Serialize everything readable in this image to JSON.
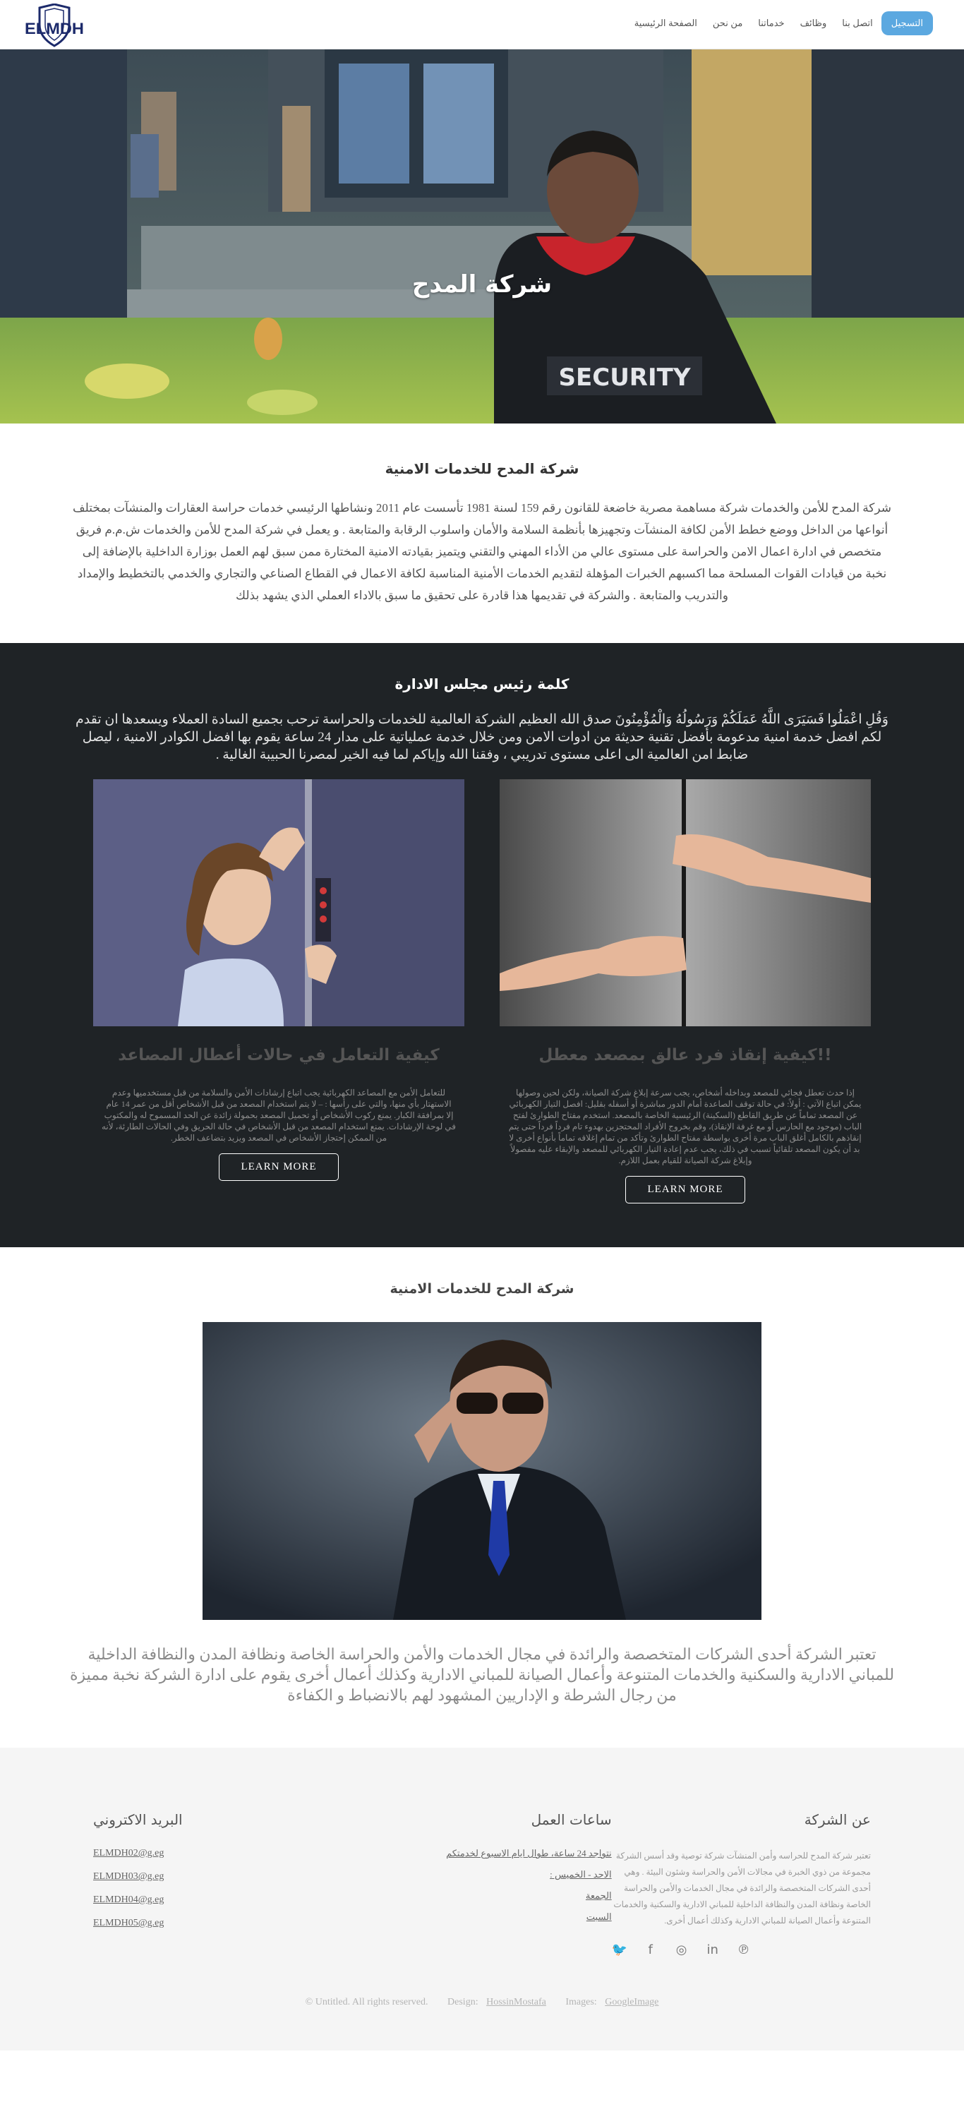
{
  "header": {
    "logo_text": "ELMDH",
    "nav": {
      "signup": "التسجيل",
      "contact": "اتصل بنا",
      "jobs": "وظائف",
      "services": "خدماتنا",
      "about": "من نحن",
      "home": "الصفحة الرئيسية"
    }
  },
  "hero": {
    "title": "شركة المدح",
    "vest_text": "SECURITY"
  },
  "intro": {
    "title": "شركة المدح للخدمات الامنية",
    "body": "شركة المدح للأمن والخدمات شركة مساهمة مصرية خاضعة للقانون رقم 159 لسنة 1981 تأسست عام 2011 ونشاطها الرئيسي خدمات حراسة العقارات والمنشآت بمختلف أنواعها من الداخل ووضع خطط الأمن لكافة المنشآت وتجهيزها بأنظمة السلامة والأمان واسلوب الرقابة والمتابعة . و يعمل في شركة المدح للأمن والخدمات ش.م.م فريق متخصص في ادارة اعمال الامن والحراسة على مستوى عالي من الأداء المهني والتقني ويتميز بقيادته الامنية المختارة ممن سبق لهم العمل بوزارة الداخلية بالإضافة إلى نخبة من قيادات القوات المسلحة مما اكسبهم الخبرات المؤهلة لتقديم الخدمات الأمنية المناسبة لكافة الاعمال في القطاع الصناعي والتجاري والخدمي بالتخطيط والإمداد والتدريب والمتابعة . والشركة في تقديمها هذا قادرة على تحقيق ما سبق بالاداء العملي الذي يشهد بذلك"
  },
  "chairman": {
    "title": "كلمة رئيس مجلس الادارة",
    "body": "وَقُلِ اعْمَلُوا فَسَيَرَى اللَّهُ عَمَلَكُمْ وَرَسُولُهُ وَالْمُؤْمِنُونَ صدق الله العظيم الشركة العالمية للخدمات والحراسة ترحب بجميع السادة العملاء ويسعدها ان تقدم لكم افضل خدمة امنية مدعومة بأفضل تقنية حديثة من ادوات الامن ومن خلال خدمة عملياتية على مدار 24 ساعة يقوم بها افضل الكوادر الامنية ، ليصل ضابط امن العالمية الى اعلى مستوى تدريبي ، وفقنا الله وإياكم لما فيه الخير لمصرنا الحبيبة الغالية .",
    "cards": [
      {
        "title": "كيفية إنقاذ فرد عالق بمصعد معطل!!",
        "body": "إذا حدث تعطل فجائي للمصعد وبداخله أشخاص، يجب سرعة إبلاغ شركة الصيانة، ولكن لحين وصولها يمكن اتباع الآتي : أولاً: في حالة توقف الصاعدة أمام الدور مباشرة أو أسفله بقليل: افصل التيار الكهربائي عن المصعد تماماً عن طريق القاطع (السكينة) الرئيسية الخاصة بالمصعد. استخدم مفتاح الطوارئ لفتح الباب (موجود مع الحارس أو مع غرفة الإنقاذ)، وقم بخروج الأفراد المحتجزين بهدوء تام فرداً فرداً حتى يتم إنقاذهم بالكامل أغلق الباب مرة أخرى بواسطة مفتاح الطوارئ وتأكد من تمام إغلاقه تماماً بأنواع أخرى لا بد أن يكون المصعد تلقائياً تسبب في ذلك، يجب عدم إعادة التيار الكهربائي للمصعد والإبقاء عليه مفصولاً وإبلاغ شركة الصيانة للقيام بعمل اللازم.",
        "button": "LEARN MORE"
      },
      {
        "title": "كيفية التعامل في حالات أعطال المصاعد",
        "body": "للتعامل الأمن مع المصاعد الكهربائية يجب اتباع إرشادات الأمن والسلامة من قبل مستخدميها وعدم الاستهتار بأي منها، والتي على رأسها : – لا يتم استخدام المصعد من قبل الأشخاص أقل من عمر 14 عام إلا بمرافقة الكبار. يمنع ركوب الأشخاص أو تحميل المصعد بحمولة زائدة عن الحد المسموح له والمكتوب في لوحة الإرشادات. يمنع استخدام المصعد من قبل الأشخاص في حالة الحريق وفي الحالات الطارئة، لأنه من الممكن إحتجاز الأشخاص في المصعد ويزيد بتضاعف الخطر.",
        "button": "LEARN MORE"
      }
    ]
  },
  "about": {
    "title": "شركة المدح للخدمات الامنية",
    "body": "تعتبر الشركة أحدى الشركات المتخصصة والرائدة في مجال الخدمات والأمن والحراسة الخاصة ونظافة المدن والنظافة الداخلية للمباني الادارية والسكنية والخدمات المتنوعة وأعمال الصيانة للمباني الادارية وكذلك أعمال أخرى يقوم على ادارة الشركة نخبة مميزة من رجال الشرطة و الإداريين المشهود لهم بالانضباط و الكفاءة"
  },
  "footer": {
    "company": {
      "title": "عن الشركة",
      "body": "تعتبر شركة المدح للحراسه وأمن المنشآت شركة توصية وقد أسس الشركة مجموعة من ذوي الخبرة في مجالات الأمن والحراسة وشئون البيئة . وهي أحدى الشركات المتخصصة والرائدة في مجال الخدمات والأمن والحراسة الخاصة ونظافة المدن والنظافة الداخلية للمباني الادارية والسكنية والخدمات المتنوعة وأعمال الصيانة للمباني الادارية وكذلك أعمال أخرى."
    },
    "hours": {
      "title": "ساعات العمل",
      "items": [
        "نتواجد 24 ساعة، طوال ايام الاسبوع لخدمتكم",
        "الاحد - الخميس :",
        "الجمعة",
        "السبت"
      ]
    },
    "emails": {
      "title": "البريد الاكتروني",
      "items": [
        "ELMDH02@g.eg",
        "ELMDH03@g.eg",
        "ELMDH04@g.eg",
        "ELMDH05@g.eg"
      ]
    },
    "socials": [
      "twitter-icon",
      "facebook-icon",
      "instagram-icon",
      "linkedin-icon",
      "pinterest-icon"
    ],
    "copyright": "© Untitled. All rights reserved.",
    "design_label": "Design:",
    "design_link": "HossinMostafa",
    "images_label": "Images:",
    "images_link": "GoogleImage"
  },
  "colors": {
    "accent": "#5ba8e0",
    "dark_section": "#1f2326",
    "footer_bg": "#f5f5f5",
    "logo": "#1c2a6b"
  }
}
